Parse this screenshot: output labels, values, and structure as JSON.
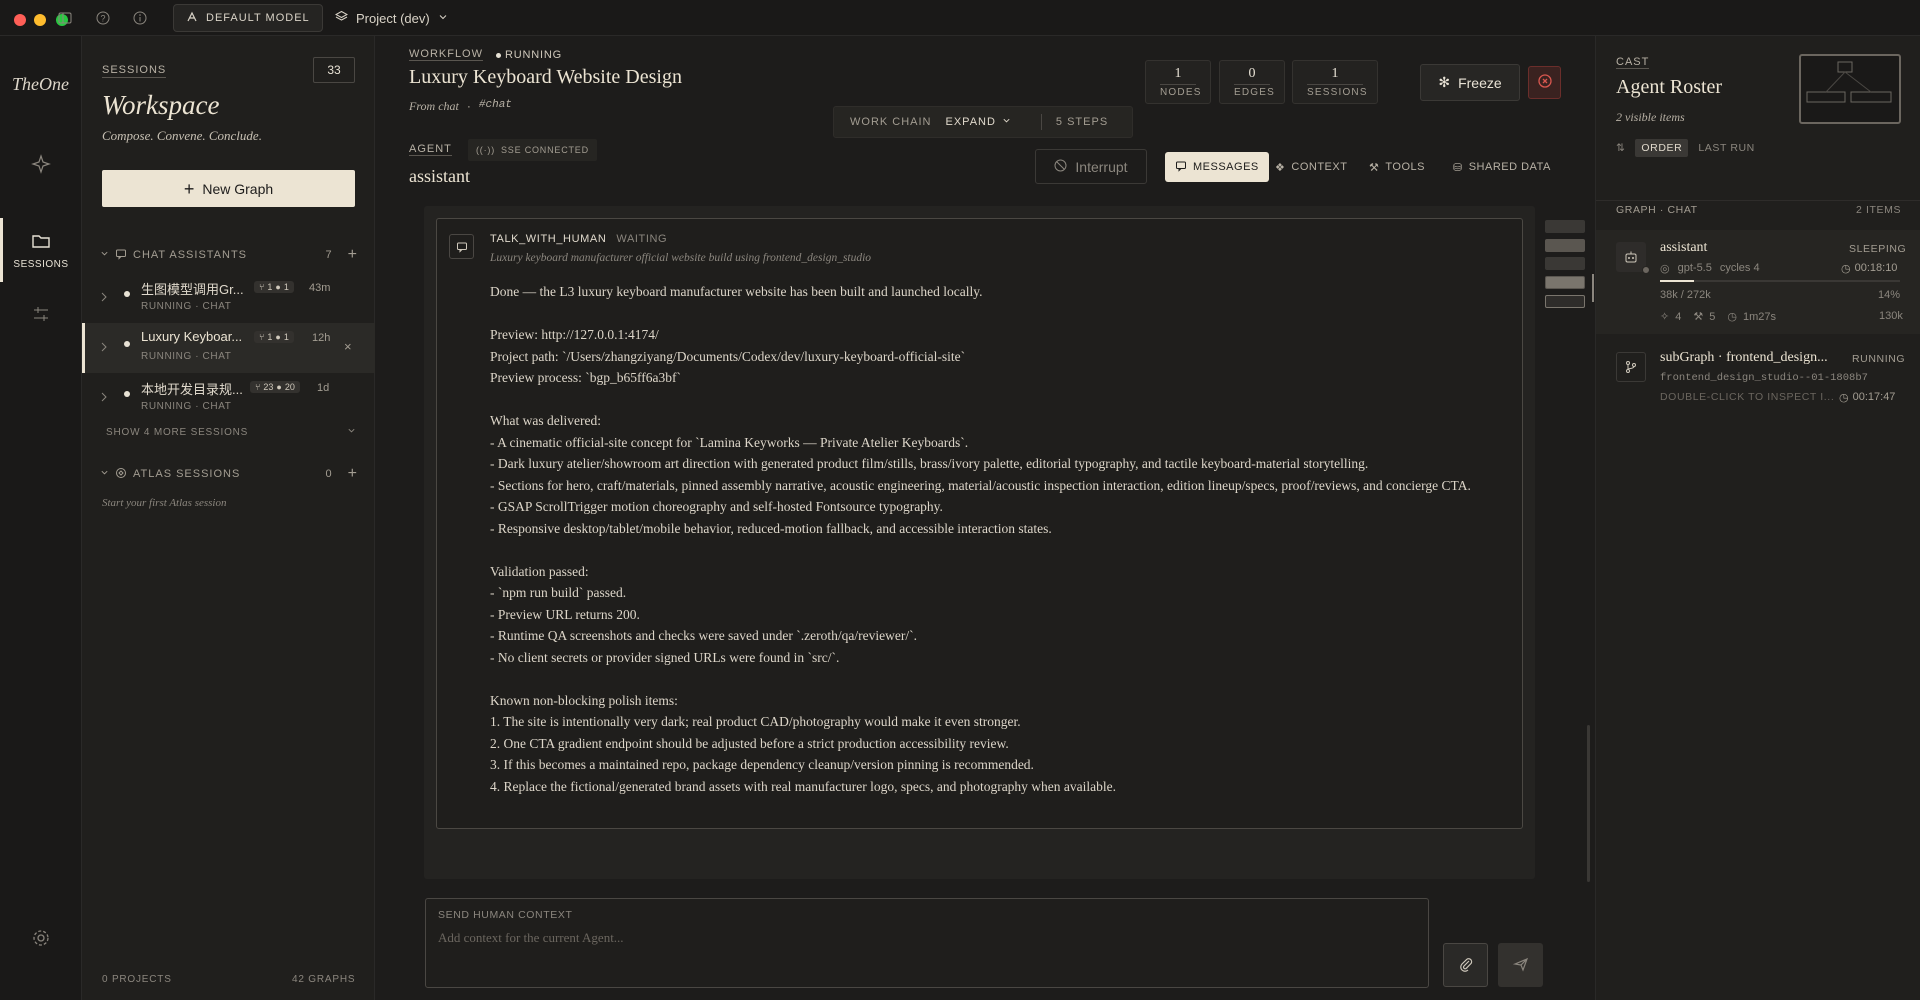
{
  "topbar": {
    "default_model_label": "DEFAULT MODEL",
    "project_label": "Project (dev)"
  },
  "rail": {
    "logo": "TheOne",
    "sessions_label": "SESSIONS"
  },
  "sidebar": {
    "section_label": "SESSIONS",
    "count": "33",
    "title": "Workspace",
    "tagline": "Compose. Convene. Conclude.",
    "new_graph_label": "New Graph",
    "chat_assistants": {
      "label": "CHAT ASSISTANTS",
      "count": "7",
      "items": [
        {
          "title": "生图模型调用Gr...",
          "status": "RUNNING · CHAT",
          "b1": "1",
          "b2": "1",
          "time": "43m"
        },
        {
          "title": "Luxury Keyboar...",
          "status": "RUNNING · CHAT",
          "b1": "1",
          "b2": "1",
          "time": "12h"
        },
        {
          "title": "本地开发目录规...",
          "status": "RUNNING · CHAT",
          "b1": "23",
          "b2": "20",
          "time": "1d"
        }
      ],
      "show_more": "SHOW 4 MORE SESSIONS"
    },
    "atlas": {
      "label": "ATLAS SESSIONS",
      "count": "0",
      "empty": "Start your first Atlas session"
    },
    "footer": {
      "projects": "0 PROJECTS",
      "graphs": "42 GRAPHS"
    }
  },
  "workflow": {
    "label": "WORKFLOW",
    "status": "RUNNING",
    "title": "Luxury Keyboard Website Design",
    "source": "From chat",
    "tag": "#chat",
    "stats": [
      {
        "value": "1",
        "label": "NODES"
      },
      {
        "value": "0",
        "label": "EDGES"
      },
      {
        "value": "1",
        "label": "SESSIONS"
      }
    ],
    "freeze_label": "Freeze",
    "work_chain": {
      "label": "WORK CHAIN",
      "expand": "EXPAND",
      "steps": "5 STEPS"
    }
  },
  "agent": {
    "label": "AGENT",
    "sse": "SSE CONNECTED",
    "name": "assistant",
    "interrupt_label": "Interrupt",
    "tabs": [
      "MESSAGES",
      "CONTEXT",
      "TOOLS",
      "SHARED DATA"
    ]
  },
  "message": {
    "type": "TALK_WITH_HUMAN",
    "state": "WAITING",
    "subtitle": "Luxury keyboard manufacturer official website build using frontend_design_studio",
    "paragraphs": [
      "Done — the L3 luxury keyboard manufacturer website has been built and launched locally.",
      "Preview: http://127.0.0.1:4174/\nProject path: `/Users/zhangziyang/Documents/Codex/dev/luxury-keyboard-official-site`\nPreview process: `bgp_b65ff6a3bf`",
      "What was delivered:\n- A cinematic official-site concept for `Lamina Keyworks — Private Atelier Keyboards`.\n- Dark luxury atelier/showroom art direction with generated product film/stills, brass/ivory palette, editorial typography, and tactile keyboard-material storytelling.\n- Sections for hero, craft/materials, pinned assembly narrative, acoustic engineering, material/acoustic inspection interaction, edition lineup/specs, proof/reviews, and concierge CTA.\n- GSAP ScrollTrigger motion choreography and self-hosted Fontsource typography.\n- Responsive desktop/tablet/mobile behavior, reduced-motion fallback, and accessible interaction states.",
      "Validation passed:\n- `npm run build` passed.\n- Preview URL returns 200.\n- Runtime QA screenshots and checks were saved under `.zeroth/qa/reviewer/`.\n- No client secrets or provider signed URLs were found in `src/`.",
      "Known non-blocking polish items:\n1. The site is intentionally very dark; real product CAD/photography would make it even stronger.\n2. One CTA gradient endpoint should be adjusted before a strict production accessibility review.\n3. If this becomes a maintained repo, package dependency cleanup/version pinning is recommended.\n4. Replace the fictional/generated brand assets with real manufacturer logo, specs, and photography when available."
    ]
  },
  "input": {
    "label": "SEND HUMAN CONTEXT",
    "placeholder": "Add context for the current Agent..."
  },
  "cast": {
    "label": "CAST",
    "title": "Agent Roster",
    "subtitle": "2 visible items",
    "order": "ORDER",
    "last_run": "LAST RUN",
    "section": "GRAPH · CHAT",
    "section_count": "2 ITEMS",
    "agents": [
      {
        "name": "assistant",
        "state": "SLEEPING",
        "model": "gpt-5.5",
        "cycles": "cycles 4",
        "time": "00:18:10",
        "tokens": "38k / 272k",
        "percent": "14%",
        "progress": 0.14,
        "m1": "4",
        "m2": "5",
        "duration": "1m27s",
        "total": "130k"
      },
      {
        "name": "subGraph · frontend_design...",
        "state": "RUNNING",
        "id": "frontend_design_studio--01-1808b7",
        "hint": "DOUBLE-CLICK TO INSPECT I...",
        "time": "00:17:47"
      }
    ]
  },
  "colors": {
    "accent": "#ece4d3",
    "danger": "#c0433f",
    "bg": "#1d1c1b"
  }
}
